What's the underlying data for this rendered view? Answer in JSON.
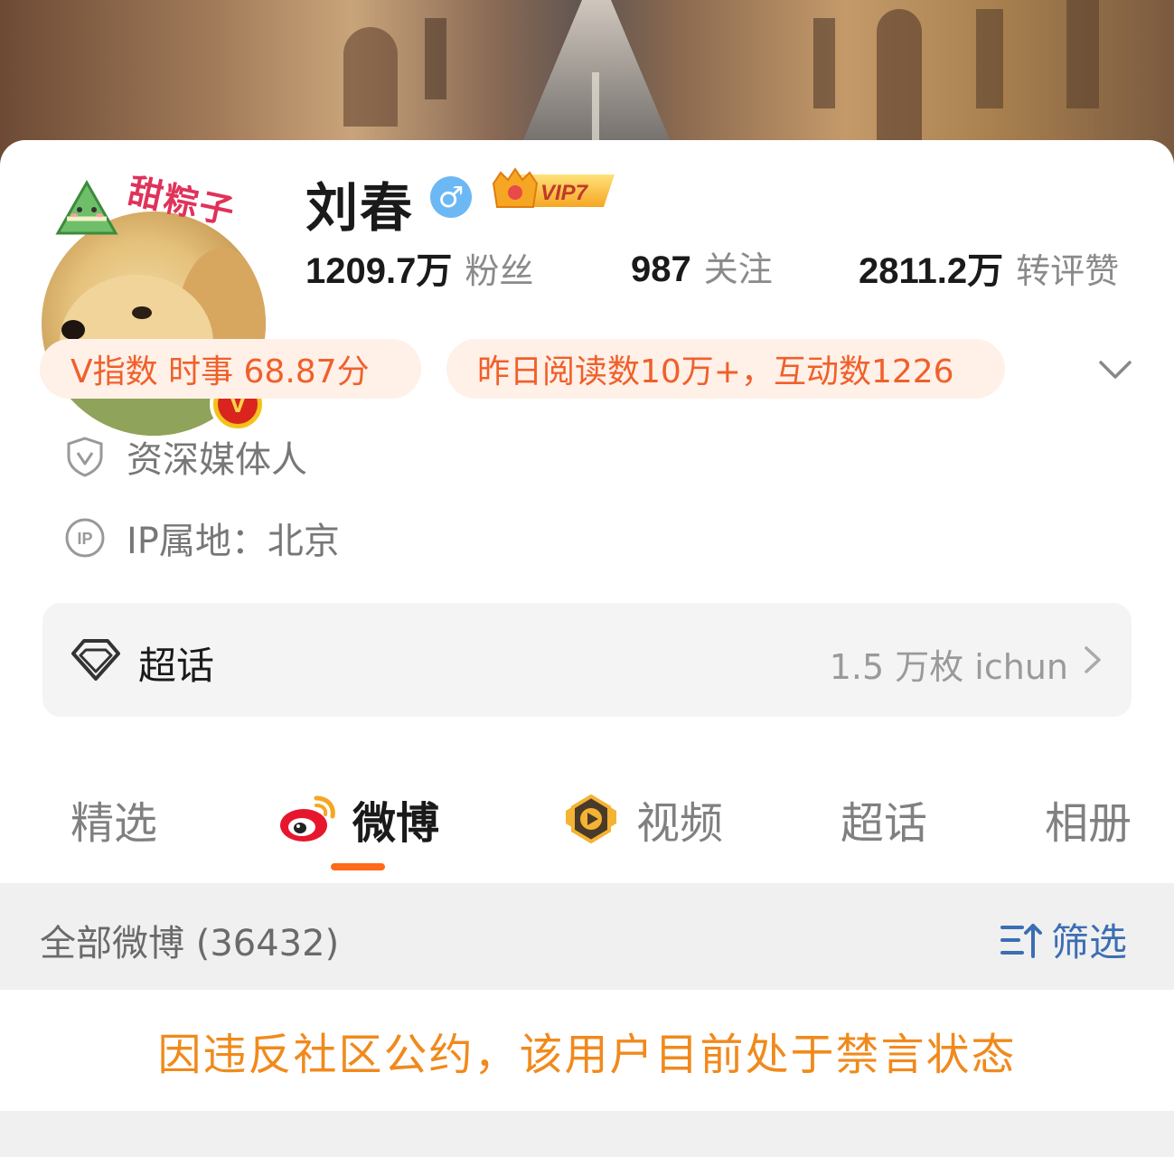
{
  "profile": {
    "sticker_text": "甜粽子",
    "name": "刘春",
    "gender_symbol": "♂",
    "vip_label": "VIP7",
    "verified_badge": "V"
  },
  "stats": [
    {
      "value": "1209.7万",
      "label": "粉丝"
    },
    {
      "value": "987",
      "label": "关注"
    },
    {
      "value": "2811.2万",
      "label": "转评赞"
    }
  ],
  "pills": {
    "v_index": "V指数 时事 68.87分",
    "reads": "昨日阅读数10万+，互动数1226"
  },
  "info": {
    "title": "资深媒体人",
    "ip": "IP属地：北京"
  },
  "chaohua": {
    "label": "超话",
    "right_text": "1.5 万枚 ichun"
  },
  "tabs": [
    {
      "label": "精选",
      "icon": "none"
    },
    {
      "label": "微博",
      "icon": "weibo-logo-icon",
      "active": true
    },
    {
      "label": "视频",
      "icon": "video-play-icon"
    },
    {
      "label": "超话",
      "icon": "none"
    },
    {
      "label": "相册",
      "icon": "none"
    }
  ],
  "filterbar": {
    "count_text": "全部微博 (36432)",
    "filter_label": "筛选"
  },
  "notice": "因违反社区公约，该用户目前处于禁言状态",
  "colors": {
    "accent_orange": "#ff6a1a",
    "pill_bg": "#fff0e8",
    "pill_text": "#f0602a",
    "notice_text": "#f08a1c",
    "filter_blue": "#3c6eb4"
  }
}
